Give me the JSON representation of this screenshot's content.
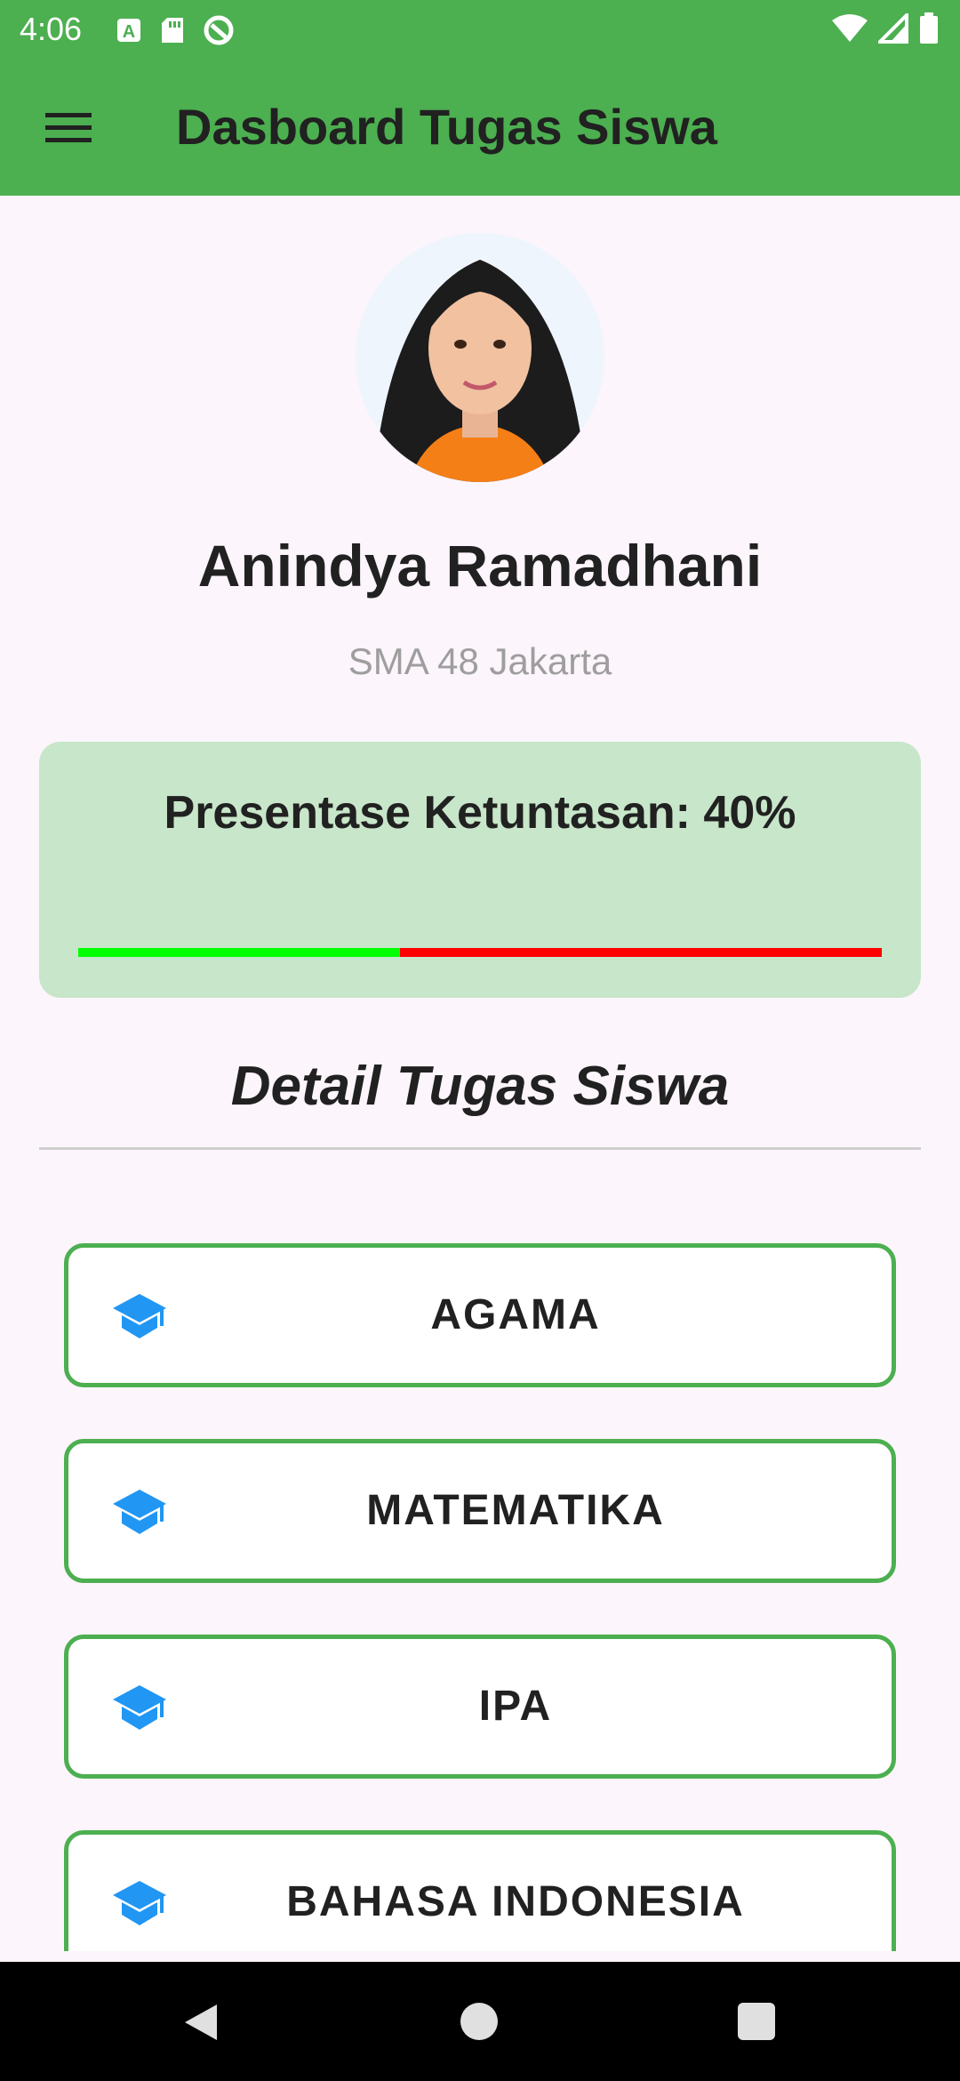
{
  "status_bar": {
    "time": "4:06",
    "left_icons": [
      "a-notification-icon",
      "sd-card-icon",
      "sync-icon"
    ],
    "right_icons": [
      "wifi-icon",
      "signal-icon",
      "battery-icon"
    ]
  },
  "app_bar": {
    "title": "Dasboard Tugas Siswa",
    "menu_icon": "hamburger-menu-icon",
    "background": "#4caf50"
  },
  "profile": {
    "name": "Anindya Ramadhani",
    "school": "SMA 48 Jakarta"
  },
  "progress": {
    "label": "Presentase Ketuntasan: 40%",
    "value_percent": 40,
    "complete_color": "#00ff00",
    "remaining_color": "#ff0000",
    "card_color": "#c8e6c9"
  },
  "section": {
    "title": "Detail Tugas Siswa"
  },
  "subjects": [
    {
      "label": "AGAMA",
      "icon": "graduation-cap-icon"
    },
    {
      "label": "MATEMATIKA",
      "icon": "graduation-cap-icon"
    },
    {
      "label": "IPA",
      "icon": "graduation-cap-icon"
    },
    {
      "label": "BAHASA INDONESIA",
      "icon": "graduation-cap-icon"
    }
  ],
  "colors": {
    "accent": "#4caf50",
    "icon_blue": "#2196f3"
  }
}
